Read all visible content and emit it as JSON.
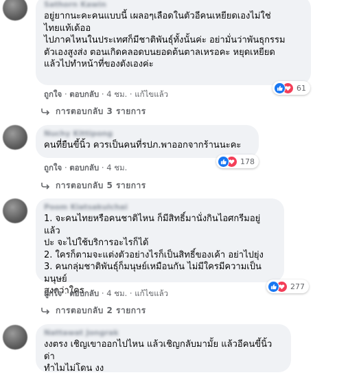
{
  "comments": [
    {
      "author": "Sathorn Kawin",
      "text": "อยู่ยากนะคะคนแบบนี้ เผลอๆเลือดในตัวอีคนเหยียดเองไม่ใช่\nไทยแท้เด้ออ\nไปภาคไหนในประเทศก็มีชาติพันธุ์ทั้งนั้นค่ะ อย่ามั่นว่าพันธุกรรม\nตัวเองสูงส่ง ตอนเกิดคลอดบนยอดต้นตาลเหรอคะ หยุดเหยียด\nแล้วไปทำหน้าที่ของตังเองค่ะ",
      "like": "ถูกใจ",
      "reply": "ตอบกลับ",
      "time": "4 ชม.",
      "edited": "แก้ไขแล้ว",
      "reaction_count": "61",
      "replies_label": "การตอบกลับ 3 รายการ"
    },
    {
      "author": "Nuchy Kittipong",
      "text": "คนที่ยืนขี้นิ้ว ควรเป็นคนที่รปภ.พาออกจากร้านนะคะ",
      "like": "ถูกใจ",
      "reply": "ตอบกลับ",
      "time": "4 ชม.",
      "reaction_count": "178",
      "replies_label": "การตอบกลับ 5 รายการ"
    },
    {
      "author": "Poom Kiatsakulchai",
      "text": "1. จะคนไทยหรือคนชาติไหน ก็มีสิทธิ์มานั่งกินไอศกรีมอยู่แล้ว\nปะ จะไปใช้บริการอะไรก็ได้\n2. ใครก็ตามจะแต่งตัวอย่างไรก็เป็นสิทธิ์ของเค้า อย่าไปยุ่ง\n3. คนกลุ่มชาติพันธุ์ก็มนุษย์เหมือนกัน ไม่มีใครมีความเป็นมนุษย์\nสูงกว่าใคร",
      "like": "ถูกใจ",
      "reply": "ตอบกลับ",
      "time": "4 ชม.",
      "edited": "แก้ไขแล้ว",
      "reaction_count": "277",
      "replies_label": "การตอบกลับ 2 รายการ"
    },
    {
      "author": "Nattawat Jongrak",
      "text": "งงตรง เชิญเขาออกไปไหน แล้วเชิญกลับมามั้ย แล้วอีคนขี้นิ้วด่า\nทำไมไม่โดน งง"
    }
  ],
  "icons": {
    "reply_arrow": "reply-arrow-icon",
    "like": "like-reaction-icon",
    "love": "love-reaction-icon"
  },
  "colors": {
    "like": "#1877f2",
    "love": "#f33e58",
    "bubble": "#f0f2f5",
    "meta": "#65676b"
  }
}
